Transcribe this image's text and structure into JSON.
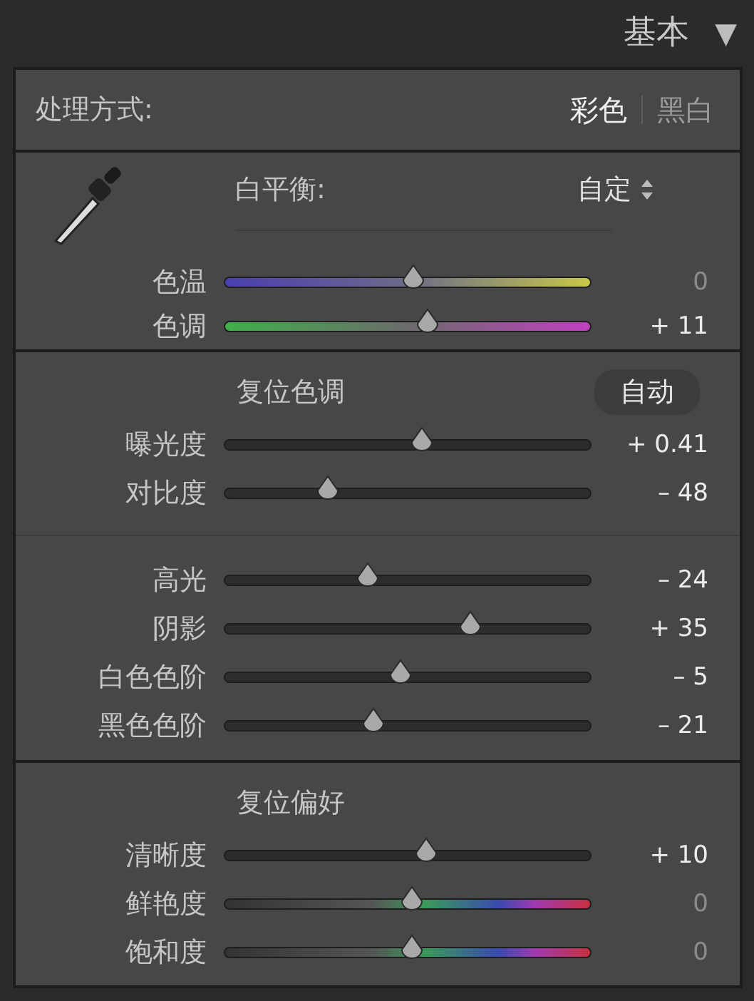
{
  "header": {
    "title": "基本",
    "toggle": "▼"
  },
  "treatment": {
    "label": "处理方式:",
    "options": [
      {
        "label": "彩色",
        "selected": true
      },
      {
        "label": "黑白",
        "selected": false
      }
    ]
  },
  "white_balance": {
    "label": "白平衡:",
    "value": "自定",
    "sliders": [
      {
        "label": "色温",
        "kind": "temp",
        "level": 0.515,
        "reading": "0",
        "modified": false
      },
      {
        "label": "色调",
        "kind": "tint",
        "level": 0.555,
        "reading": "+ 11",
        "modified": true
      }
    ]
  },
  "tone": {
    "reset": "复位色调",
    "auto": "自动",
    "sliders": [
      {
        "label": "曝光度",
        "kind": "plain",
        "level": 0.54,
        "reading": "+ 0.41",
        "modified": true
      },
      {
        "label": "对比度",
        "kind": "plain",
        "level": 0.28,
        "reading": "– 48",
        "modified": true
      }
    ],
    "sliders_2": [
      {
        "label": "高光",
        "kind": "plain",
        "level": 0.39,
        "reading": "– 24",
        "modified": true
      },
      {
        "label": "阴影",
        "kind": "plain",
        "level": 0.67,
        "reading": "+ 35",
        "modified": true
      },
      {
        "label": "白色色阶",
        "kind": "plain",
        "level": 0.48,
        "reading": "– 5",
        "modified": true
      },
      {
        "label": "黑色色阶",
        "kind": "plain",
        "level": 0.405,
        "reading": "– 21",
        "modified": true
      }
    ]
  },
  "presence": {
    "reset": "复位偏好",
    "sliders": [
      {
        "label": "清晰度",
        "kind": "plain",
        "level": 0.55,
        "reading": "+ 10",
        "modified": true
      },
      {
        "label": "鲜艳度",
        "kind": "spectrum",
        "level": 0.51,
        "reading": "0",
        "modified": false
      },
      {
        "label": "饱和度",
        "kind": "spectrum",
        "level": 0.51,
        "reading": "0",
        "modified": false
      }
    ]
  }
}
